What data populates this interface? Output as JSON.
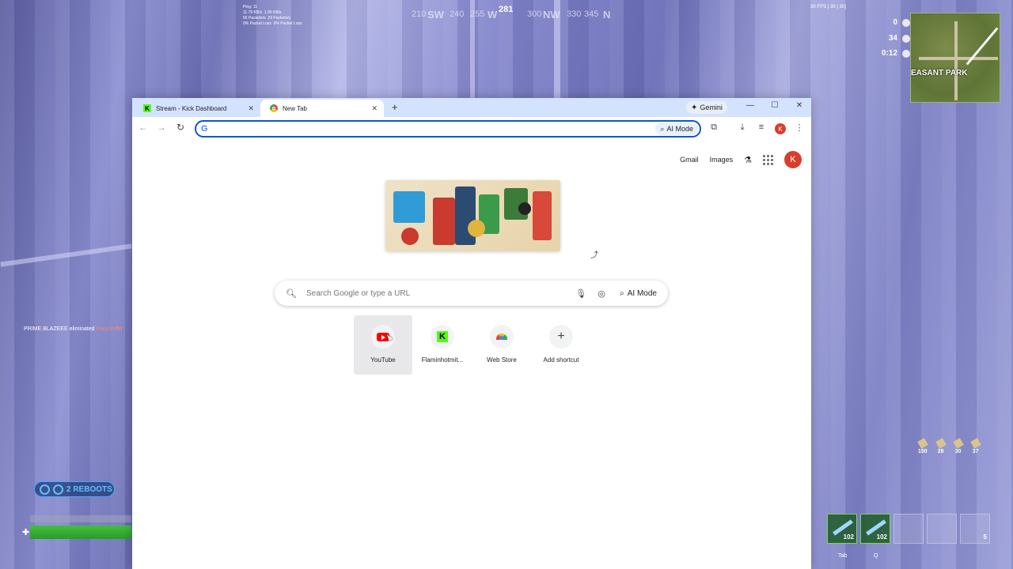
{
  "game_hud": {
    "compass": {
      "heading": "281",
      "markers": [
        "210",
        "SW",
        "240",
        "255",
        "W",
        "300",
        "NW",
        "330",
        "345",
        "N"
      ]
    },
    "net_stats": [
      "Ping: 11",
      "11.79 KB/s",
      "1.95 KB/s",
      "66 Packets/s",
      "29 Packets/s",
      "0% Packet Loss",
      "0% Packet Loss"
    ],
    "fps": "30 FPS [ 30 | 30]",
    "stats": [
      {
        "icon": "skull-icon",
        "value": "0"
      },
      {
        "icon": "players-icon",
        "value": "34"
      },
      {
        "icon": "clock-icon",
        "value": "0:12"
      }
    ],
    "minimap_label": "EASANT PARK",
    "elim_feed": {
      "killer": "PRIME BLAZEEE",
      "verb": "eliminated",
      "victim": "PurpSniffrr"
    },
    "reboots": "2 REBOOTS",
    "ammo": [
      "150",
      "28",
      "30",
      "37"
    ],
    "hotbar": [
      {
        "count": "102",
        "state": "filled"
      },
      {
        "count": "102",
        "state": "filled"
      },
      {
        "count": "",
        "state": "empty"
      },
      {
        "count": "",
        "state": "empty"
      },
      {
        "count": "5",
        "state": "empty"
      }
    ],
    "keyhints": [
      "Tab",
      "Q"
    ]
  },
  "browser": {
    "tabs": [
      {
        "title": "Stream - Kick Dashboard",
        "favicon": "kick-icon",
        "active": false
      },
      {
        "title": "New Tab",
        "favicon": "chrome-icon",
        "active": true
      }
    ],
    "new_tab_symbol": "+",
    "gemini_label": "Gemini",
    "omnibox": {
      "value": "",
      "placeholder": "",
      "ai_mode_label": "AI Mode"
    },
    "profile_initial": "K"
  },
  "newtab": {
    "top_links": {
      "gmail": "Gmail",
      "images": "Images"
    },
    "avatar_initial": "K",
    "search": {
      "placeholder": "Search Google or type a URL",
      "ai_mode_label": "AI Mode"
    },
    "shortcuts": [
      {
        "label": "YouTube",
        "icon": "youtube-icon"
      },
      {
        "label": "Flaminhotmit...",
        "icon": "kick-icon"
      },
      {
        "label": "Web Store",
        "icon": "webstore-icon"
      },
      {
        "label": "Add shortcut",
        "icon": "plus-icon"
      }
    ]
  },
  "colors": {
    "accent": "#0b57d0",
    "tabstrip": "#d3e3fd",
    "kick_green": "#53fc18",
    "youtube_red": "#ff0000",
    "avatar": "#d93d2b"
  }
}
